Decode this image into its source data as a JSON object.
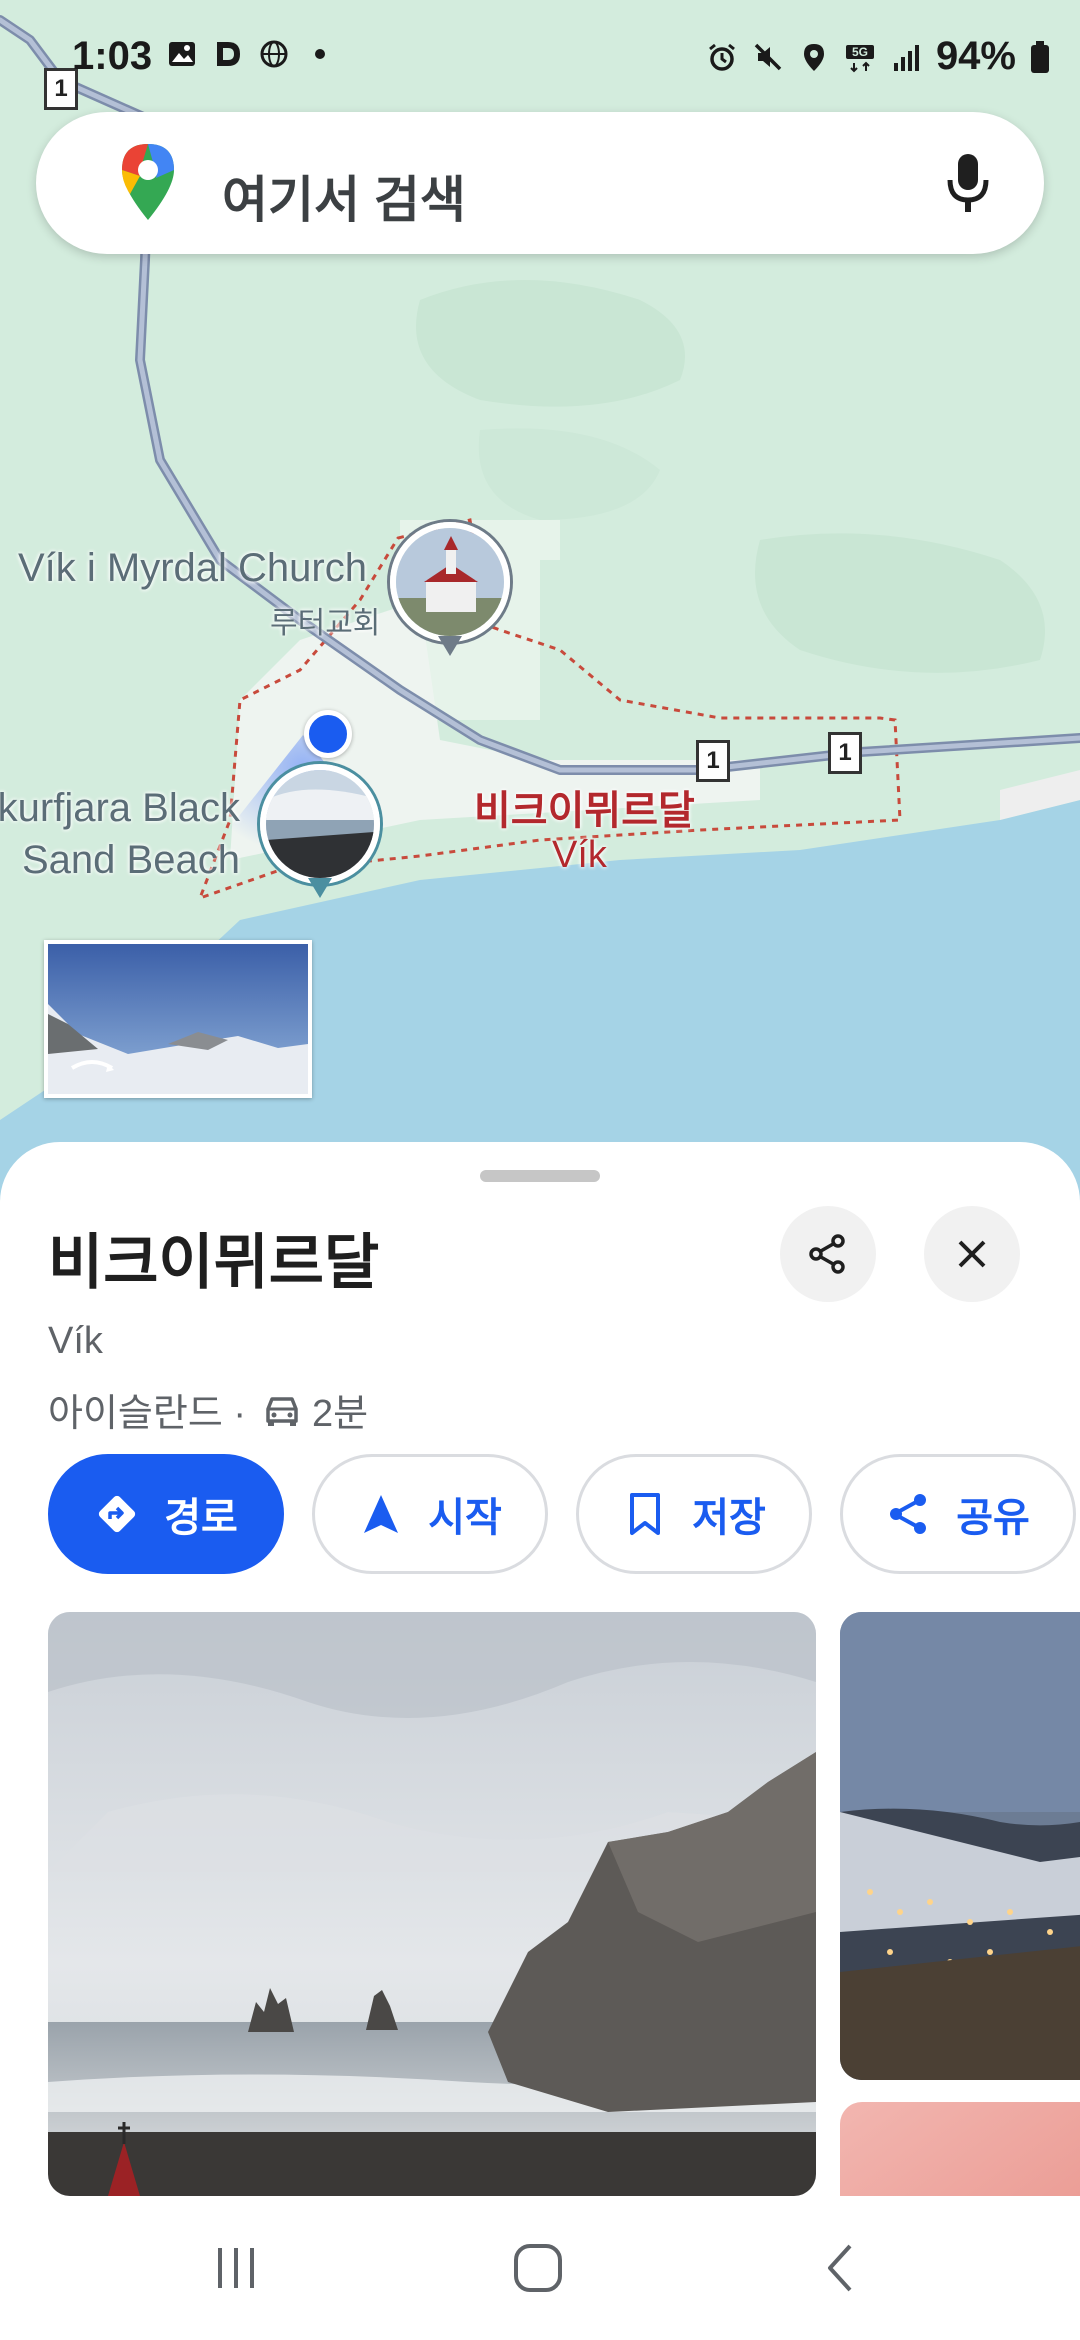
{
  "status_bar": {
    "time": "1:03",
    "battery": "94%",
    "left_icons": [
      "gallery-icon",
      "d-app-icon",
      "globe-icon",
      "dot-icon"
    ],
    "right_icons": [
      "alarm-icon",
      "mute-icon",
      "location-icon",
      "5g-icon",
      "signal-icon",
      "battery-icon"
    ]
  },
  "search": {
    "placeholder": "여기서 검색",
    "icons": [
      "google-maps-pin-icon",
      "mic-icon"
    ]
  },
  "map": {
    "road_shields": [
      "1",
      "1",
      "1"
    ],
    "church_label": "Vík i Myrdal Church",
    "church_sub": "루터교회",
    "beach_label_line1": "kurfjara Black",
    "beach_label_line2": "Sand Beach",
    "town_label": "비크이뮈르달",
    "town_sub": "Vík"
  },
  "place": {
    "title": "비크이뮈르달",
    "subtitle": "Vík",
    "country": "아이슬란드 ·",
    "drive_time": "2분"
  },
  "actions": {
    "route": "경로",
    "start": "시작",
    "save": "저장",
    "share": "공유"
  },
  "colors": {
    "accent": "#1a5cf0",
    "map_land": "#d3ecdd",
    "map_water": "#a5d3e6",
    "town_label": "#b3282d"
  }
}
